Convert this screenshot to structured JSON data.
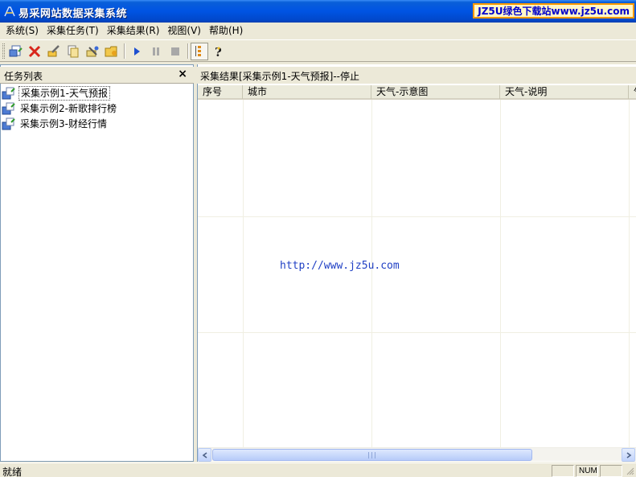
{
  "window": {
    "title": "易采网站数据采集系统",
    "watermark_prefix": "JZ5U绿色下载站",
    "watermark_url": "www.jz5u.com"
  },
  "menu": {
    "items": [
      {
        "label": "系统(S)"
      },
      {
        "label": "采集任务(T)"
      },
      {
        "label": "采集结果(R)"
      },
      {
        "label": "视图(V)"
      },
      {
        "label": "帮助(H)"
      }
    ]
  },
  "toolbar": {
    "buttons": [
      "new-task-icon",
      "delete-icon",
      "edit-icon",
      "copy-icon",
      "tools-icon",
      "open-folder-icon",
      "play-icon",
      "pause-icon",
      "stop-icon",
      "list-icon",
      "help-icon"
    ]
  },
  "task_panel": {
    "title": "任务列表",
    "close_glyph": "×",
    "tasks": [
      {
        "label": "采集示例1-天气预报",
        "selected": true
      },
      {
        "label": "采集示例2-新歌排行榜",
        "selected": false
      },
      {
        "label": "采集示例3-财经行情",
        "selected": false
      }
    ]
  },
  "results_panel": {
    "title": "采集结果[采集示例1-天气预报]--停止",
    "columns": [
      "序号",
      "城市",
      "天气-示意图",
      "天气-说明",
      "气"
    ],
    "center_text": "http://www.jz5u.com"
  },
  "statusbar": {
    "text": "就绪",
    "num": "NUM"
  },
  "colors": {
    "titlebar": "#0054e3",
    "watermark_border": "#ff9900",
    "link_text": "#1f3fc4"
  }
}
